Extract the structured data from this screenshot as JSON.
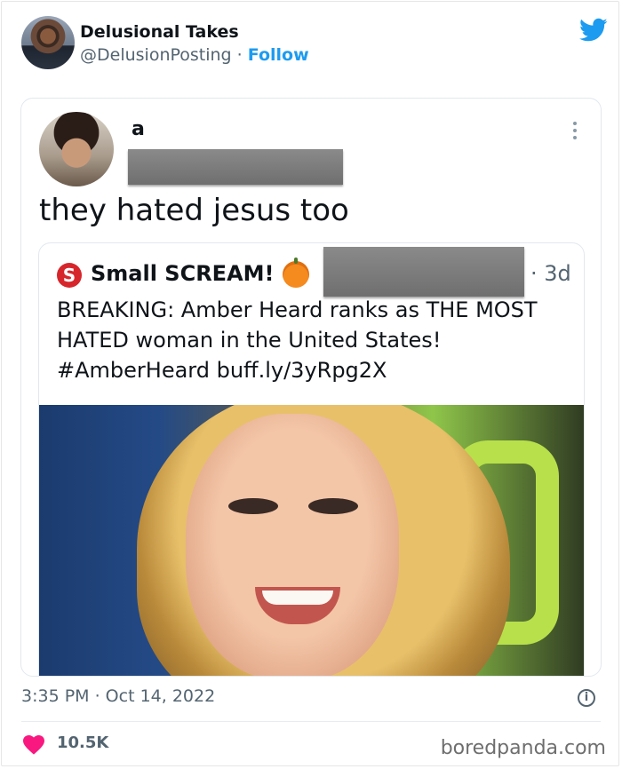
{
  "tweet": {
    "display_name": "Delusional Takes",
    "handle": "@DelusionPosting",
    "separator": "·",
    "follow_label": "Follow",
    "timestamp": "3:35 PM · Oct 14, 2022",
    "likes": "10.5K",
    "accent_color": "#1d9bf0",
    "like_color": "#f91880"
  },
  "embedded": {
    "author_name": "a",
    "text": "they hated jesus too",
    "quoted": {
      "author_name": "Small SCREAM!",
      "icon_letter": "S",
      "age": "· 3d",
      "text": "BREAKING: Amber Heard ranks as THE MOST HATED woman in the United States! #AmberHeard buff.ly/3yRpg2X"
    }
  },
  "watermark": "boredpanda.com",
  "icons": {
    "brand": "twitter-bird-icon",
    "more": "more-options-icon",
    "info": "info-icon",
    "like": "heart-icon"
  }
}
